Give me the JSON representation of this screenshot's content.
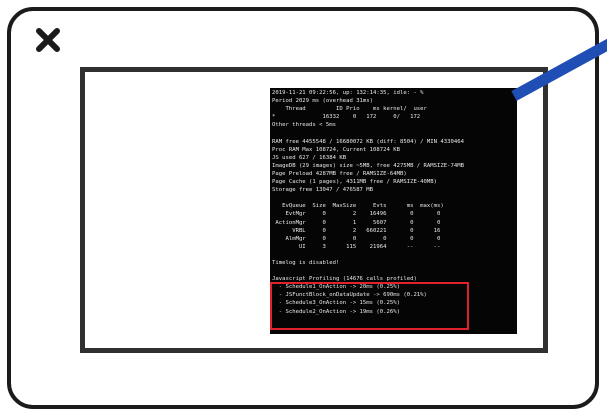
{
  "icons": {
    "close": "close-icon"
  },
  "colors": {
    "frame": "#1b1b1b",
    "screen_border": "#303030",
    "terminal_bg": "#050505",
    "terminal_text": "#e8e8e8",
    "highlight": "#e0222a",
    "pointer": "#1f4fb5"
  },
  "terminal": {
    "lines": [
      "2019-11-21 09:22:56, up: 132:14:35, idle: - %",
      "Period 2029 ms (overhead 31ms)",
      "    Thread         ID Prio    ms kernel/  user",
      "*              16332    0   172     0/   172",
      "Other threads < 5ms",
      "",
      "RAM free 4455548 / 16680072 KB (diff: 8504) / MIN 4330464",
      "Proc RAM Max 108724, Current 108724 KB",
      "JS used 627 / 16384 KB",
      "ImageDB (29 images) size ~5MB, free 4275MB / RAMSIZE-74MB",
      "Page Preload 4287MB free / RAMSIZE-64MB)",
      "Page Cache (1 pages), 4311MB free / RAMSIZE-40MB)",
      "Storage free 13047 / 476587 MB",
      "",
      "   EvQueue  Size  MaxSize     Evts      ms  max(ms)",
      "    EvtMgr     0        2    16496       0       0",
      " ActionMgr     0        1     5607       0       0",
      "      VRBL     0        2   660221       0      16",
      "    AlmMgr     0        0        0       0       0",
      "        UI     3      115    21964      --      --",
      "",
      "Timelog is disabled!",
      "",
      "Javascript Profiling (14676 calls profiled)",
      "  - Schedule1_OnAction -> 20ms (0.25%)",
      "  - JSFunctBlock_onDataUpdate -> 690ms (0.21%)",
      "  - Schedule3_OnAction -> 15ms (0.25%)",
      "  - Schedule2_OnAction -> 19ms (0.26%)"
    ]
  }
}
